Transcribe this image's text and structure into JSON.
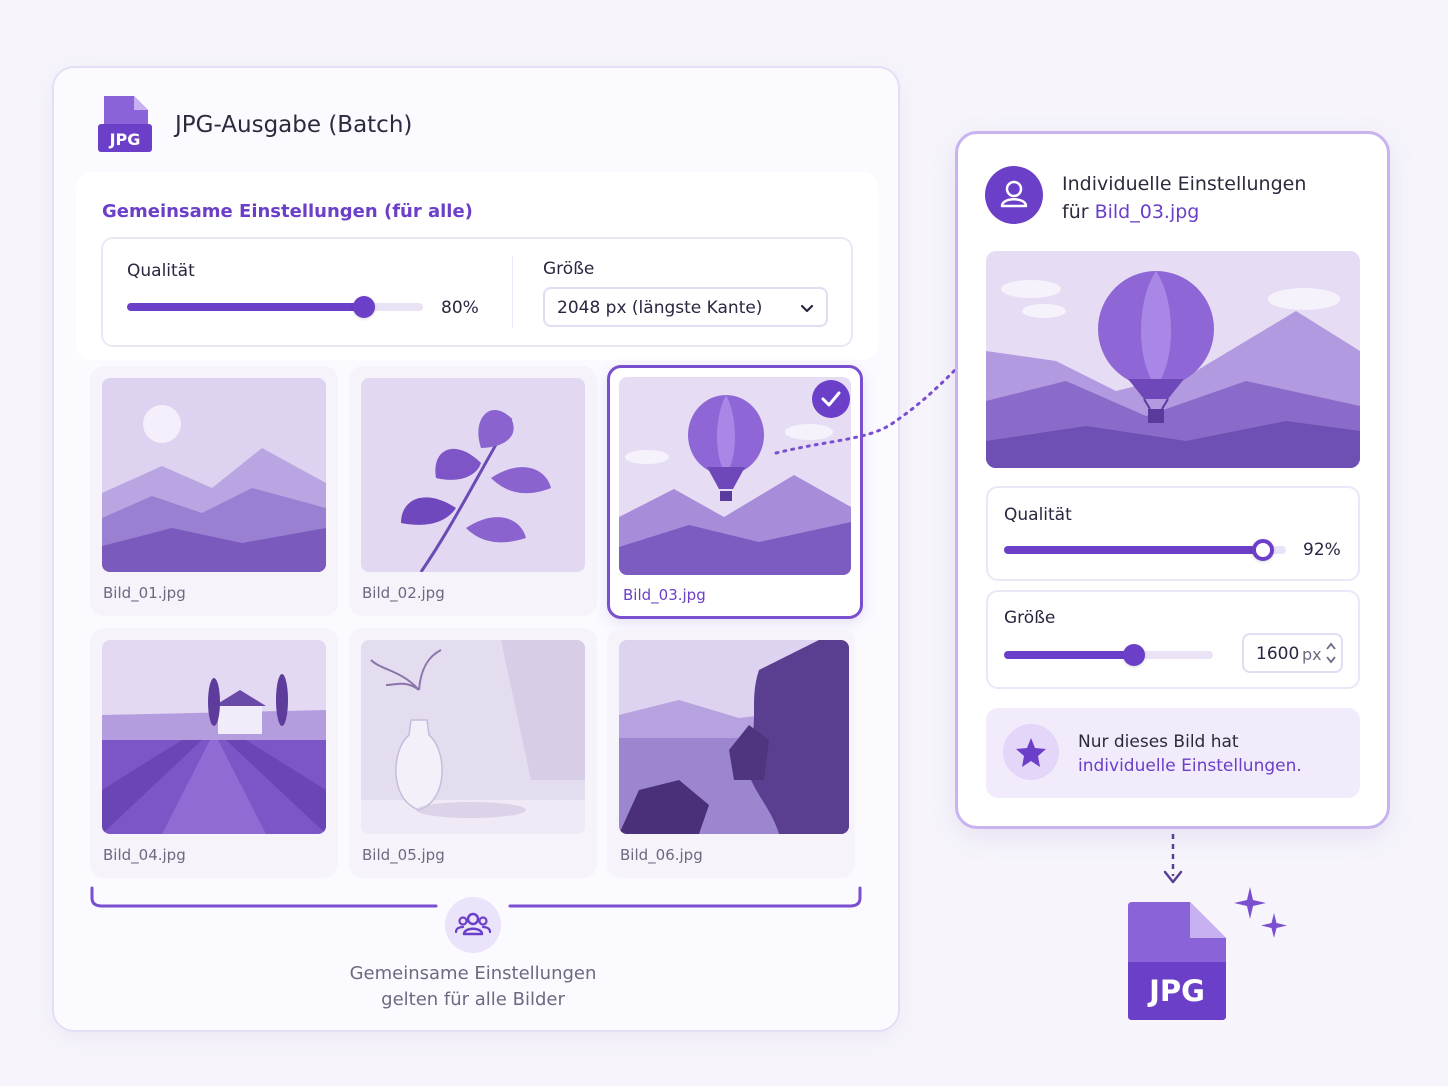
{
  "batch": {
    "title": "JPG-Ausgabe (Batch)",
    "file_badge": "JPG",
    "shared_heading": "Gemeinsame Einstellungen (für alle)",
    "quality_label": "Qualität",
    "quality_value": "80%",
    "quality_fraction": 0.8,
    "size_label": "Größe",
    "size_selected": "2048 px (längste Kante)",
    "images": [
      {
        "name": "Bild_01.jpg",
        "selected": false
      },
      {
        "name": "Bild_02.jpg",
        "selected": false
      },
      {
        "name": "Bild_03.jpg",
        "selected": true
      },
      {
        "name": "Bild_04.jpg",
        "selected": false
      },
      {
        "name": "Bild_05.jpg",
        "selected": false
      },
      {
        "name": "Bild_06.jpg",
        "selected": false
      }
    ],
    "group_caption_line1": "Gemeinsame Einstellungen",
    "group_caption_line2": "gelten für alle Bilder"
  },
  "individual": {
    "title_line1": "Individuelle Einstellungen",
    "title_prefix": "für",
    "title_file": "Bild_03.jpg",
    "quality_label": "Qualität",
    "quality_value": "92%",
    "quality_fraction": 0.92,
    "size_label": "Größe",
    "size_value": "1600",
    "size_unit": "px",
    "size_fraction": 0.62,
    "note_line1": "Nur dieses Bild hat",
    "note_line2": "individuelle Einstellungen."
  },
  "output": {
    "file_badge": "JPG"
  },
  "colors": {
    "accent": "#6b3fc8",
    "light_accent": "#ebe3fa",
    "border": "#c9b3ef"
  }
}
